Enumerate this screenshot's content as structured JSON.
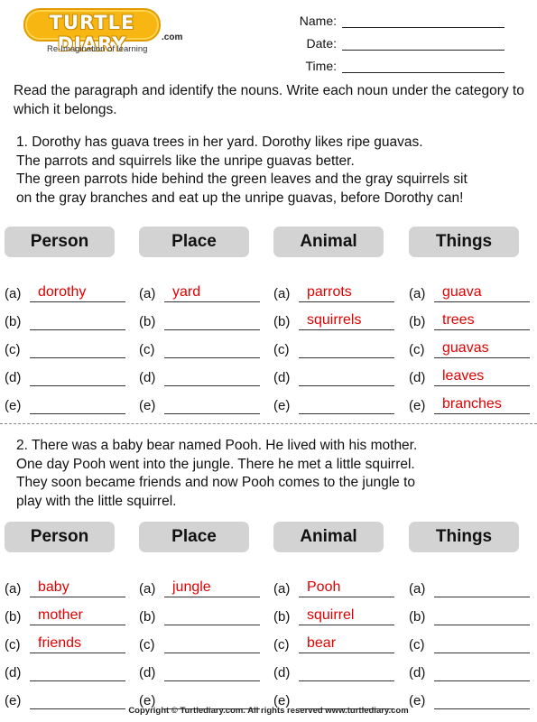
{
  "header": {
    "logo_text": "TURTLE DIARY",
    "logo_suffix": ".com",
    "tagline": "Re-Imagination of learning",
    "fields": [
      {
        "label": "Name:",
        "value": ""
      },
      {
        "label": "Date:",
        "value": ""
      },
      {
        "label": "Time:",
        "value": ""
      }
    ]
  },
  "instructions": "Read the paragraph and identify the nouns. Write each noun under the category to which it belongs.",
  "exercises": [
    {
      "paragraph_lines": [
        "1. Dorothy has guava trees in her yard. Dorothy likes ripe guavas.",
        "The parrots and squirrels like the unripe guavas better.",
        "The green parrots hide behind the green leaves and the gray squirrels sit",
        "on the gray branches and eat up the unripe guavas, before Dorothy can!"
      ],
      "categories": [
        {
          "title": "Person",
          "answers": [
            {
              "label": "(a)",
              "value": "dorothy"
            },
            {
              "label": "(b)",
              "value": ""
            },
            {
              "label": "(c)",
              "value": ""
            },
            {
              "label": "(d)",
              "value": ""
            },
            {
              "label": "(e)",
              "value": ""
            }
          ]
        },
        {
          "title": "Place",
          "answers": [
            {
              "label": "(a)",
              "value": "yard"
            },
            {
              "label": "(b)",
              "value": ""
            },
            {
              "label": "(c)",
              "value": ""
            },
            {
              "label": "(d)",
              "value": ""
            },
            {
              "label": "(e)",
              "value": ""
            }
          ]
        },
        {
          "title": "Animal",
          "answers": [
            {
              "label": "(a)",
              "value": "parrots"
            },
            {
              "label": "(b)",
              "value": "squirrels"
            },
            {
              "label": "(c)",
              "value": ""
            },
            {
              "label": "(d)",
              "value": ""
            },
            {
              "label": "(e)",
              "value": ""
            }
          ]
        },
        {
          "title": "Things",
          "answers": [
            {
              "label": "(a)",
              "value": "guava"
            },
            {
              "label": "(b)",
              "value": "trees"
            },
            {
              "label": "(c)",
              "value": "guavas"
            },
            {
              "label": "(d)",
              "value": "leaves"
            },
            {
              "label": "(e)",
              "value": "branches"
            }
          ]
        }
      ]
    },
    {
      "paragraph_lines": [
        "2. There was a baby bear named Pooh. He lived with his mother.",
        "One day Pooh went into the jungle. There he met a little squirrel.",
        "They soon became friends and now Pooh comes to the jungle to",
        "play with the little squirrel."
      ],
      "categories": [
        {
          "title": "Person",
          "answers": [
            {
              "label": "(a)",
              "value": "baby"
            },
            {
              "label": "(b)",
              "value": "mother"
            },
            {
              "label": "(c)",
              "value": "friends"
            },
            {
              "label": "(d)",
              "value": ""
            },
            {
              "label": "(e)",
              "value": ""
            }
          ]
        },
        {
          "title": "Place",
          "answers": [
            {
              "label": "(a)",
              "value": "jungle"
            },
            {
              "label": "(b)",
              "value": ""
            },
            {
              "label": "(c)",
              "value": ""
            },
            {
              "label": "(d)",
              "value": ""
            },
            {
              "label": "(e)",
              "value": ""
            }
          ]
        },
        {
          "title": "Animal",
          "answers": [
            {
              "label": "(a)",
              "value": "Pooh"
            },
            {
              "label": "(b)",
              "value": "squirrel"
            },
            {
              "label": "(c)",
              "value": "bear"
            },
            {
              "label": "(d)",
              "value": ""
            },
            {
              "label": "(e)",
              "value": ""
            }
          ]
        },
        {
          "title": "Things",
          "answers": [
            {
              "label": "(a)",
              "value": ""
            },
            {
              "label": "(b)",
              "value": ""
            },
            {
              "label": "(c)",
              "value": ""
            },
            {
              "label": "(d)",
              "value": ""
            },
            {
              "label": "(e)",
              "value": ""
            }
          ]
        }
      ]
    }
  ],
  "footer": "Copyright © Turtlediary.com. All rights reserved  www.turtlediary.com",
  "colors": {
    "answer": "#e00000",
    "header_bg": "#d3d3d3",
    "logo": "#f7b611"
  }
}
